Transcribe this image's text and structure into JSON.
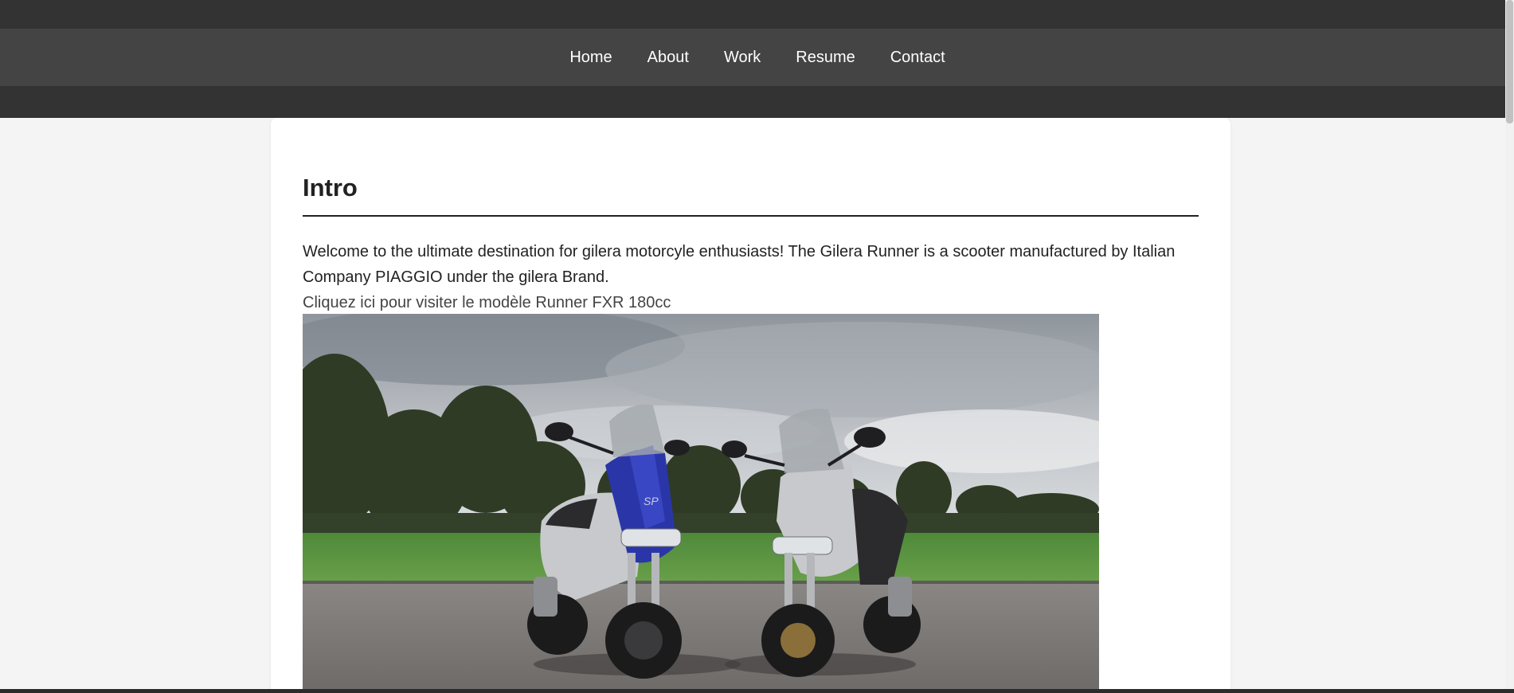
{
  "nav": {
    "items": [
      {
        "label": "Home"
      },
      {
        "label": "About"
      },
      {
        "label": "Work"
      },
      {
        "label": "Resume"
      },
      {
        "label": "Contact"
      }
    ]
  },
  "main": {
    "title": "Intro",
    "description": "Welcome to the ultimate destination for gilera motorcyle enthusiasts! The Gilera Runner is a scooter manufactured by Italian Company PIAGGIO under the gilera Brand.",
    "link_text": "Cliquez ici pour visiter le modèle Runner FXR 180cc",
    "image": {
      "subject": "two Gilera Runner scooters (blue/silver and silver) parked on asphalt in front of a green field and trees under a cloudy sky",
      "badge_text": "SP"
    }
  },
  "colors": {
    "header_band": "#333333",
    "navbar": "#444444",
    "page_bg": "#f4f4f4",
    "card_bg": "#ffffff",
    "scooter_blue": "#2a36a8",
    "scooter_silver": "#c8c9cc"
  }
}
